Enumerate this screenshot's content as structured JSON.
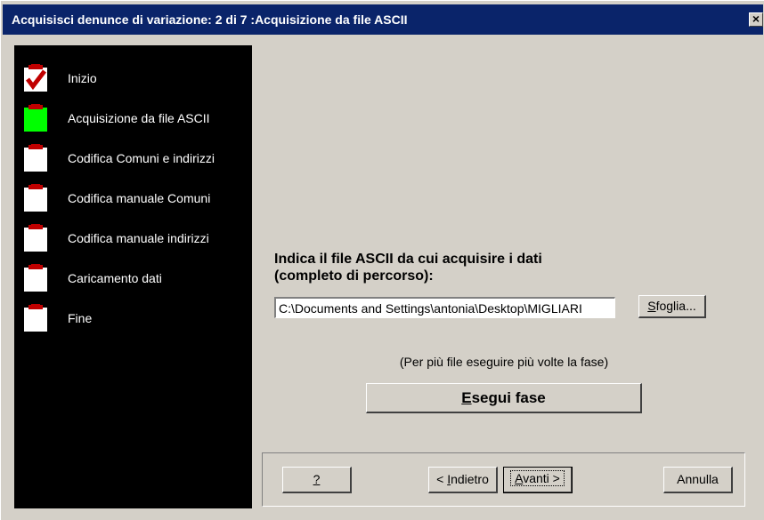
{
  "window": {
    "title": "Acquisisci denunce di variazione: 2 di 7 :Acquisizione da file ASCII",
    "close_glyph": "×"
  },
  "steps": [
    {
      "label": "Inizio",
      "state": "done",
      "icon": "clipboard-check-icon"
    },
    {
      "label": "Acquisizione da file ASCII",
      "state": "current",
      "icon": "clipboard-active-icon"
    },
    {
      "label": "Codifica Comuni e indirizzi",
      "state": "pending",
      "icon": "clipboard-icon"
    },
    {
      "label": "Codifica manuale Comuni",
      "state": "pending",
      "icon": "clipboard-icon"
    },
    {
      "label": "Codifica manuale indirizzi",
      "state": "pending",
      "icon": "clipboard-icon"
    },
    {
      "label": "Caricamento dati",
      "state": "pending",
      "icon": "clipboard-icon"
    },
    {
      "label": "Fine",
      "state": "pending",
      "icon": "clipboard-icon"
    }
  ],
  "main": {
    "prompt_line1": "Indica il file ASCII da cui acquisire i dati",
    "prompt_line2": "(completo di percorso):",
    "file_path": "C:\\Documents and Settings\\antonia\\Desktop\\MIGLIARI",
    "browse_label_u": "S",
    "browse_label_rest": "foglia...",
    "hint": "(Per più file eseguire più volte la fase)",
    "run_label_u": "E",
    "run_label_rest": "segui fase"
  },
  "footer": {
    "help_label": "?",
    "back_label_pre": "< ",
    "back_label_u": "I",
    "back_label_rest": "ndietro",
    "next_label_u": "A",
    "next_label_rest": "vanti >",
    "cancel_label": "Annulla"
  },
  "colors": {
    "title_bar": "#0a246a",
    "dialog_bg": "#d4d0c8",
    "steps_bg": "#000000",
    "active_step": "#00ff00",
    "checkmark": "#c00000"
  }
}
